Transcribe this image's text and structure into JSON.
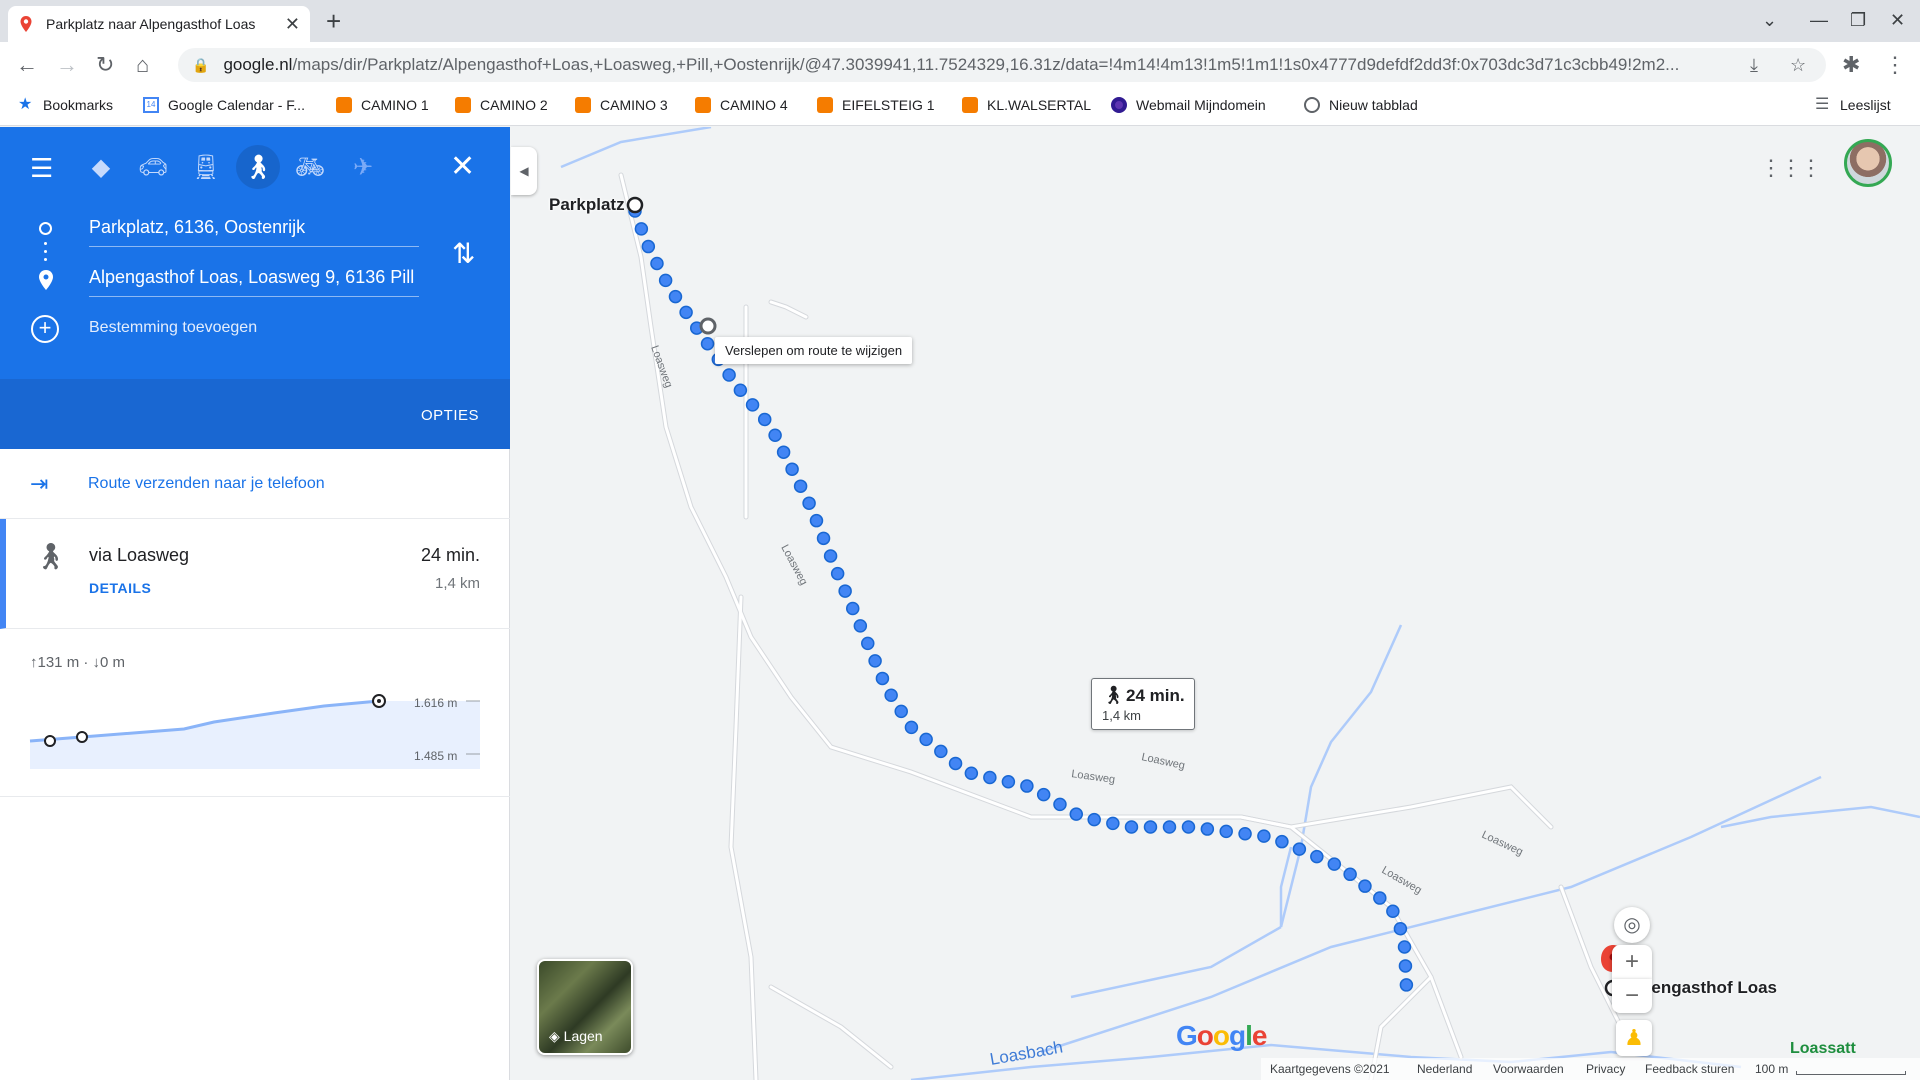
{
  "browser": {
    "tab_title": "Parkplatz naar Alpengasthof Loas",
    "url_main": "google.nl",
    "url_rest": "/maps/dir/Parkplatz/Alpengasthof+Loas,+Loasweg,+Pill,+Oostenrijk/@47.3039941,11.7524329,16.31z/data=!4m14!4m13!1m5!1m1!1s0x4777d9defdf2dd3f:0x703dc3d71c3cbb49!2m2..."
  },
  "bookmarks": [
    {
      "label": "Bookmarks",
      "icon": "star-icon"
    },
    {
      "label": "Google Calendar - F...",
      "icon": "calendar-icon"
    },
    {
      "label": "CAMINO 1",
      "icon": "blogger-icon"
    },
    {
      "label": "CAMINO 2",
      "icon": "blogger-icon"
    },
    {
      "label": "CAMINO 3",
      "icon": "blogger-icon"
    },
    {
      "label": "CAMINO 4",
      "icon": "blogger-icon"
    },
    {
      "label": "EIFELSTEIG 1",
      "icon": "blogger-icon"
    },
    {
      "label": "KL.WALSERTAL",
      "icon": "blogger-icon"
    },
    {
      "label": "Webmail Mijndomein",
      "icon": "webmail-icon"
    },
    {
      "label": "Nieuw tabblad",
      "icon": "globe-icon"
    }
  ],
  "reading_list": "Leeslijst",
  "directions": {
    "origin": "Parkplatz, 6136, Oostenrijk",
    "destination": "Alpengasthof Loas, Loasweg 9, 6136 Pill",
    "add_destination": "Bestemming toevoegen",
    "options": "OPTIES",
    "send_to_phone": "Route verzenden naar je telefoon",
    "route": {
      "via": "via Loasweg",
      "time": "24 min.",
      "distance": "1,4 km",
      "details": "DETAILS"
    },
    "elevation": {
      "summary": "↑131 m · ↓0 m",
      "max_label": "1.616 m",
      "min_label": "1.485 m"
    }
  },
  "map": {
    "drag_tooltip": "Verslepen om route te wijzigen",
    "callout_time": "24 min.",
    "callout_distance": "1,4 km",
    "start_label": "Parkplatz",
    "end_label": "Alpengasthof Loas",
    "road_name": "Loasweg",
    "stream_name": "Loasbach",
    "stream_name_2": "Loassatt",
    "layers_label": "Lagen",
    "logo": "Google",
    "footer": {
      "copyright": "Kaartgegevens ©2021",
      "country": "Nederland",
      "terms": "Voorwaarden",
      "privacy": "Privacy",
      "feedback": "Feedback sturen",
      "scale": "100 m"
    }
  }
}
